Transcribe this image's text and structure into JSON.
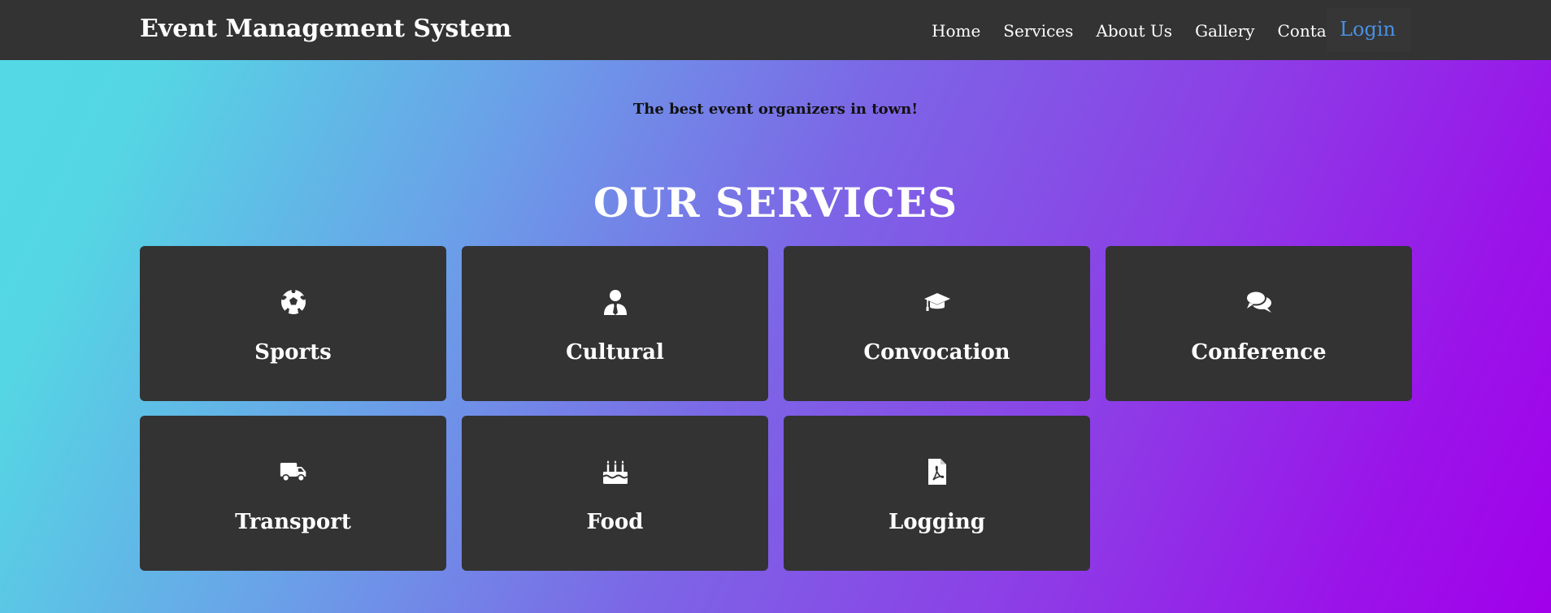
{
  "brand": {
    "title": "Event Management System"
  },
  "nav": {
    "items": [
      "Home",
      "Services",
      "About Us",
      "Gallery",
      "Contact"
    ],
    "login": "Login"
  },
  "hero": {
    "tagline": "The best event organizers in town!"
  },
  "services": {
    "title": "OUR SERVICES",
    "cards": [
      {
        "label": "Sports",
        "icon": "soccer-ball-icon"
      },
      {
        "label": "Cultural",
        "icon": "user-tie-icon"
      },
      {
        "label": "Convocation",
        "icon": "graduation-cap-icon"
      },
      {
        "label": "Conference",
        "icon": "chat-bubbles-icon"
      },
      {
        "label": "Transport",
        "icon": "truck-icon"
      },
      {
        "label": "Food",
        "icon": "birthday-cake-icon"
      },
      {
        "label": "Logging",
        "icon": "pdf-file-icon"
      }
    ]
  },
  "colors": {
    "navbar": "#333333",
    "card": "#333333",
    "login_link": "#4a90e2",
    "gradient_start": "#53d9e6",
    "gradient_end": "#a100ea"
  }
}
